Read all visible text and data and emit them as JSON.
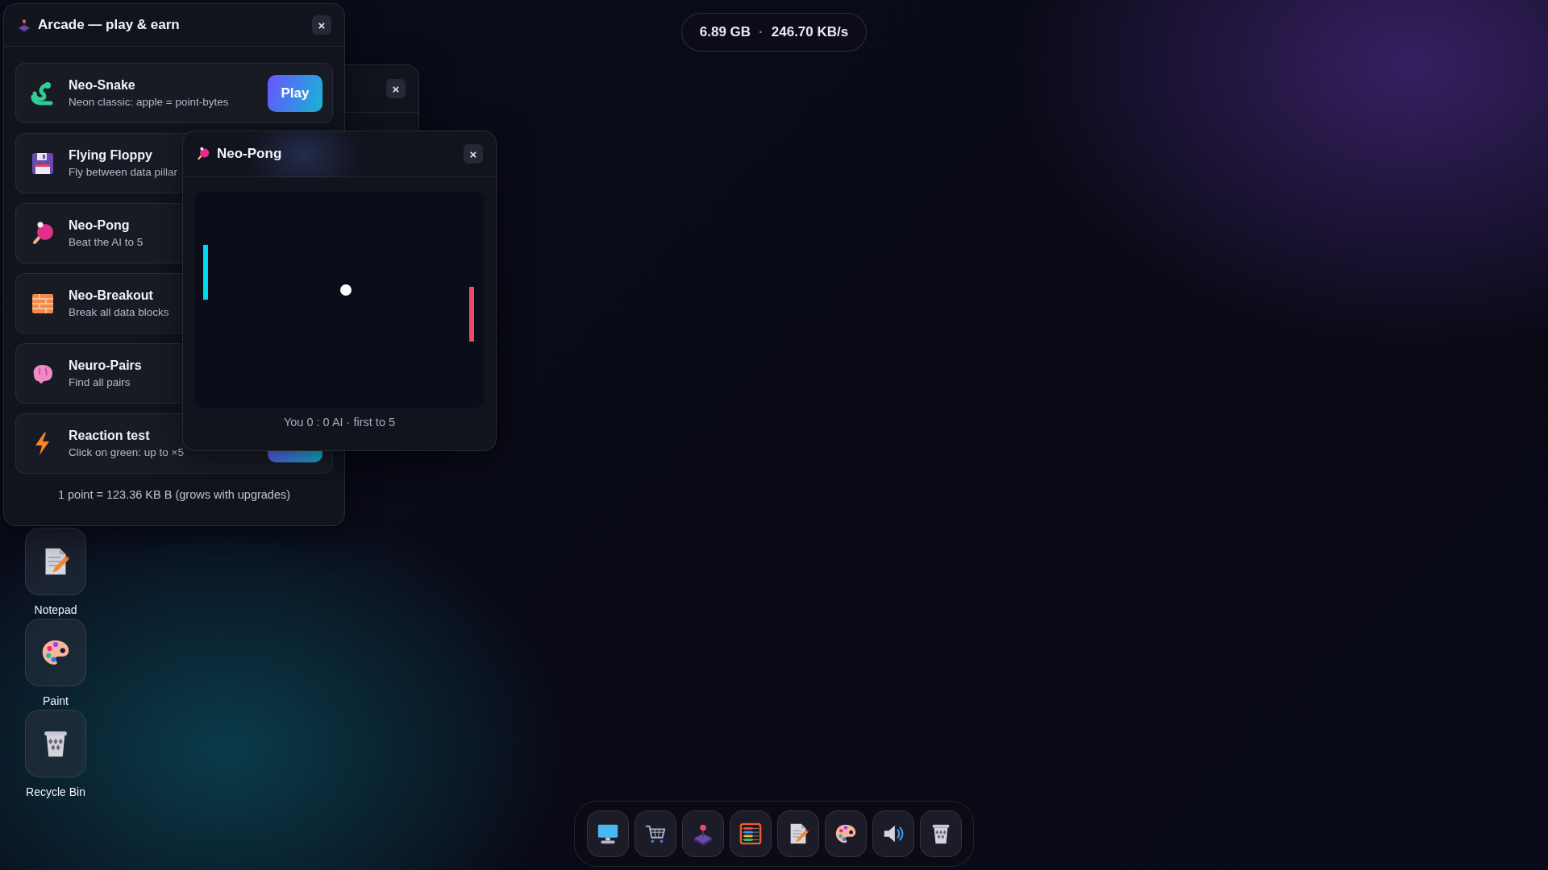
{
  "stats": {
    "storage": "6.89 GB",
    "separator": "·",
    "speed": "246.70 KB/s"
  },
  "behind_window": {
    "close": "×"
  },
  "arcade": {
    "title": "Arcade — play & earn",
    "close": "×",
    "games": [
      {
        "kind": "snake",
        "title": "Neo-Snake",
        "subtitle": "Neon classic: apple = point-bytes",
        "button": "Play"
      },
      {
        "kind": "floppy",
        "title": "Flying Floppy",
        "subtitle": "Fly between data pillar"
      },
      {
        "kind": "paddle",
        "title": "Neo-Pong",
        "subtitle": "Beat the AI to 5"
      },
      {
        "kind": "bricks",
        "title": "Neo-Breakout",
        "subtitle": "Break all data blocks"
      },
      {
        "kind": "brain",
        "title": "Neuro-Pairs",
        "subtitle": "Find all pairs"
      },
      {
        "kind": "bolt",
        "title": "Reaction test",
        "subtitle": "Click on green: up to ×5",
        "has_button": true
      }
    ],
    "footer": "1 point = 123.36 KB B (grows with upgrades)"
  },
  "pong": {
    "title": "Neo-Pong",
    "close": "×",
    "score": "You 0 : 0 AI · first to 5"
  },
  "desktop_icons": [
    {
      "kind": "notepad",
      "label": "Notepad"
    },
    {
      "kind": "palette",
      "label": "Paint"
    },
    {
      "kind": "bin",
      "label": "Recycle Bin"
    }
  ],
  "taskbar": [
    {
      "kind": "computer"
    },
    {
      "kind": "cart"
    },
    {
      "kind": "joystick"
    },
    {
      "kind": "abacus"
    },
    {
      "kind": "notepad"
    },
    {
      "kind": "palette"
    },
    {
      "kind": "speaker"
    },
    {
      "kind": "bin"
    }
  ]
}
